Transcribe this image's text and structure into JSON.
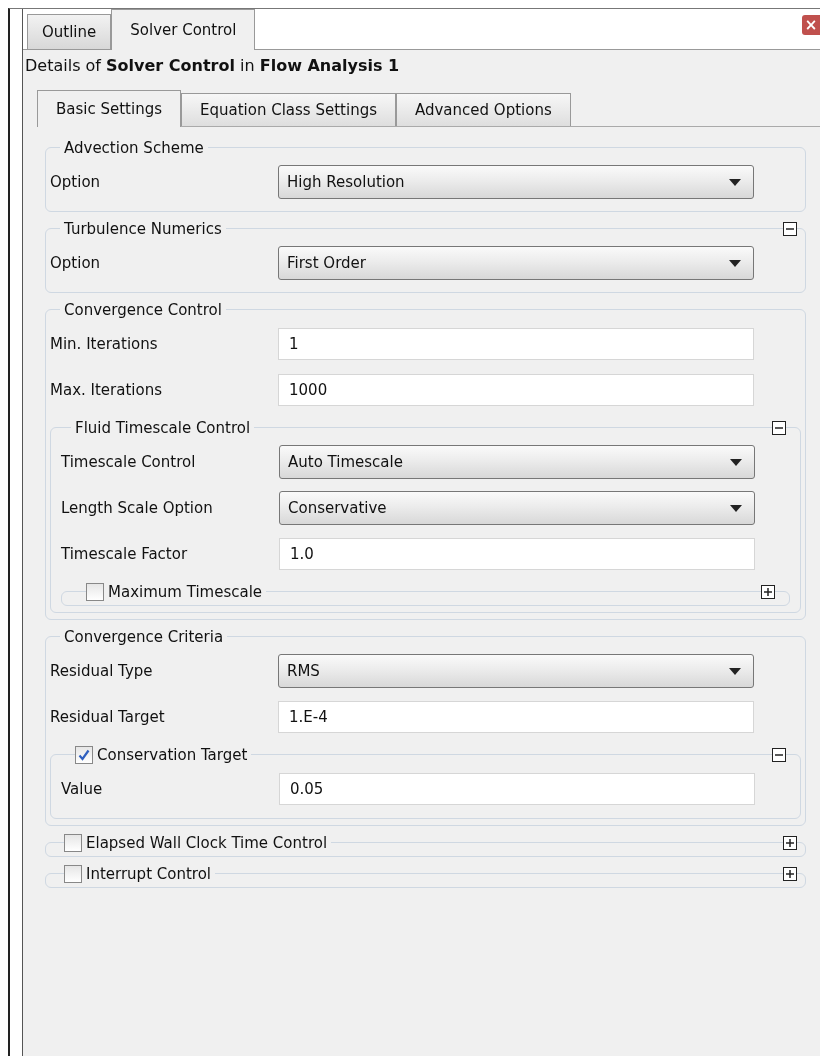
{
  "panel_tabs": [
    {
      "label": "Outline",
      "selected": false
    },
    {
      "label": "Solver Control",
      "selected": true
    }
  ],
  "close_button": {
    "label": "×"
  },
  "details": "Details of **Solver Control** in **Flow Analysis 1**",
  "settings_tabs": [
    {
      "label": "Basic Settings",
      "selected": true
    },
    {
      "label": "Equation Class Settings",
      "selected": false
    },
    {
      "label": "Advanced Options",
      "selected": false
    }
  ],
  "groups": [
    {
      "title": "Advection Scheme",
      "rows": [
        {
          "kind": "select",
          "label": "Option",
          "value": "High Resolution"
        }
      ]
    },
    {
      "title": "Turbulence Numerics",
      "expanded": true,
      "rows": [
        {
          "kind": "select",
          "label": "Option",
          "value": "First Order"
        }
      ]
    },
    {
      "title": "Convergence Control",
      "rows": [
        {
          "kind": "text",
          "label": "Min. Iterations",
          "value": "1"
        },
        {
          "kind": "text",
          "label": "Max. Iterations",
          "value": "1000"
        }
      ],
      "groups": [
        {
          "title": "Fluid Timescale Control",
          "expanded": true,
          "rows": [
            {
              "kind": "select",
              "label": "Timescale Control",
              "value": "Auto Timescale"
            },
            {
              "kind": "select",
              "label": "Length Scale Option",
              "value": "Conservative"
            },
            {
              "kind": "text",
              "label": "Timescale Factor",
              "value": "1.0"
            }
          ],
          "groups": [
            {
              "title": "Maximum Timescale",
              "checked": false,
              "expanded": false
            }
          ]
        }
      ]
    },
    {
      "title": "Convergence Criteria",
      "rows": [
        {
          "kind": "select",
          "label": "Residual Type",
          "value": "RMS"
        },
        {
          "kind": "text",
          "label": "Residual Target",
          "value": "1.E-4"
        }
      ],
      "groups": [
        {
          "title": "Conservation Target",
          "checked": true,
          "expanded": true,
          "rows": [
            {
              "kind": "text",
              "label": "Value",
              "value": "0.05"
            }
          ]
        }
      ]
    },
    {
      "title": "Elapsed Wall Clock Time Control",
      "checked": false,
      "expanded": false
    },
    {
      "title": "Interrupt Control",
      "checked": false,
      "expanded": false
    }
  ]
}
